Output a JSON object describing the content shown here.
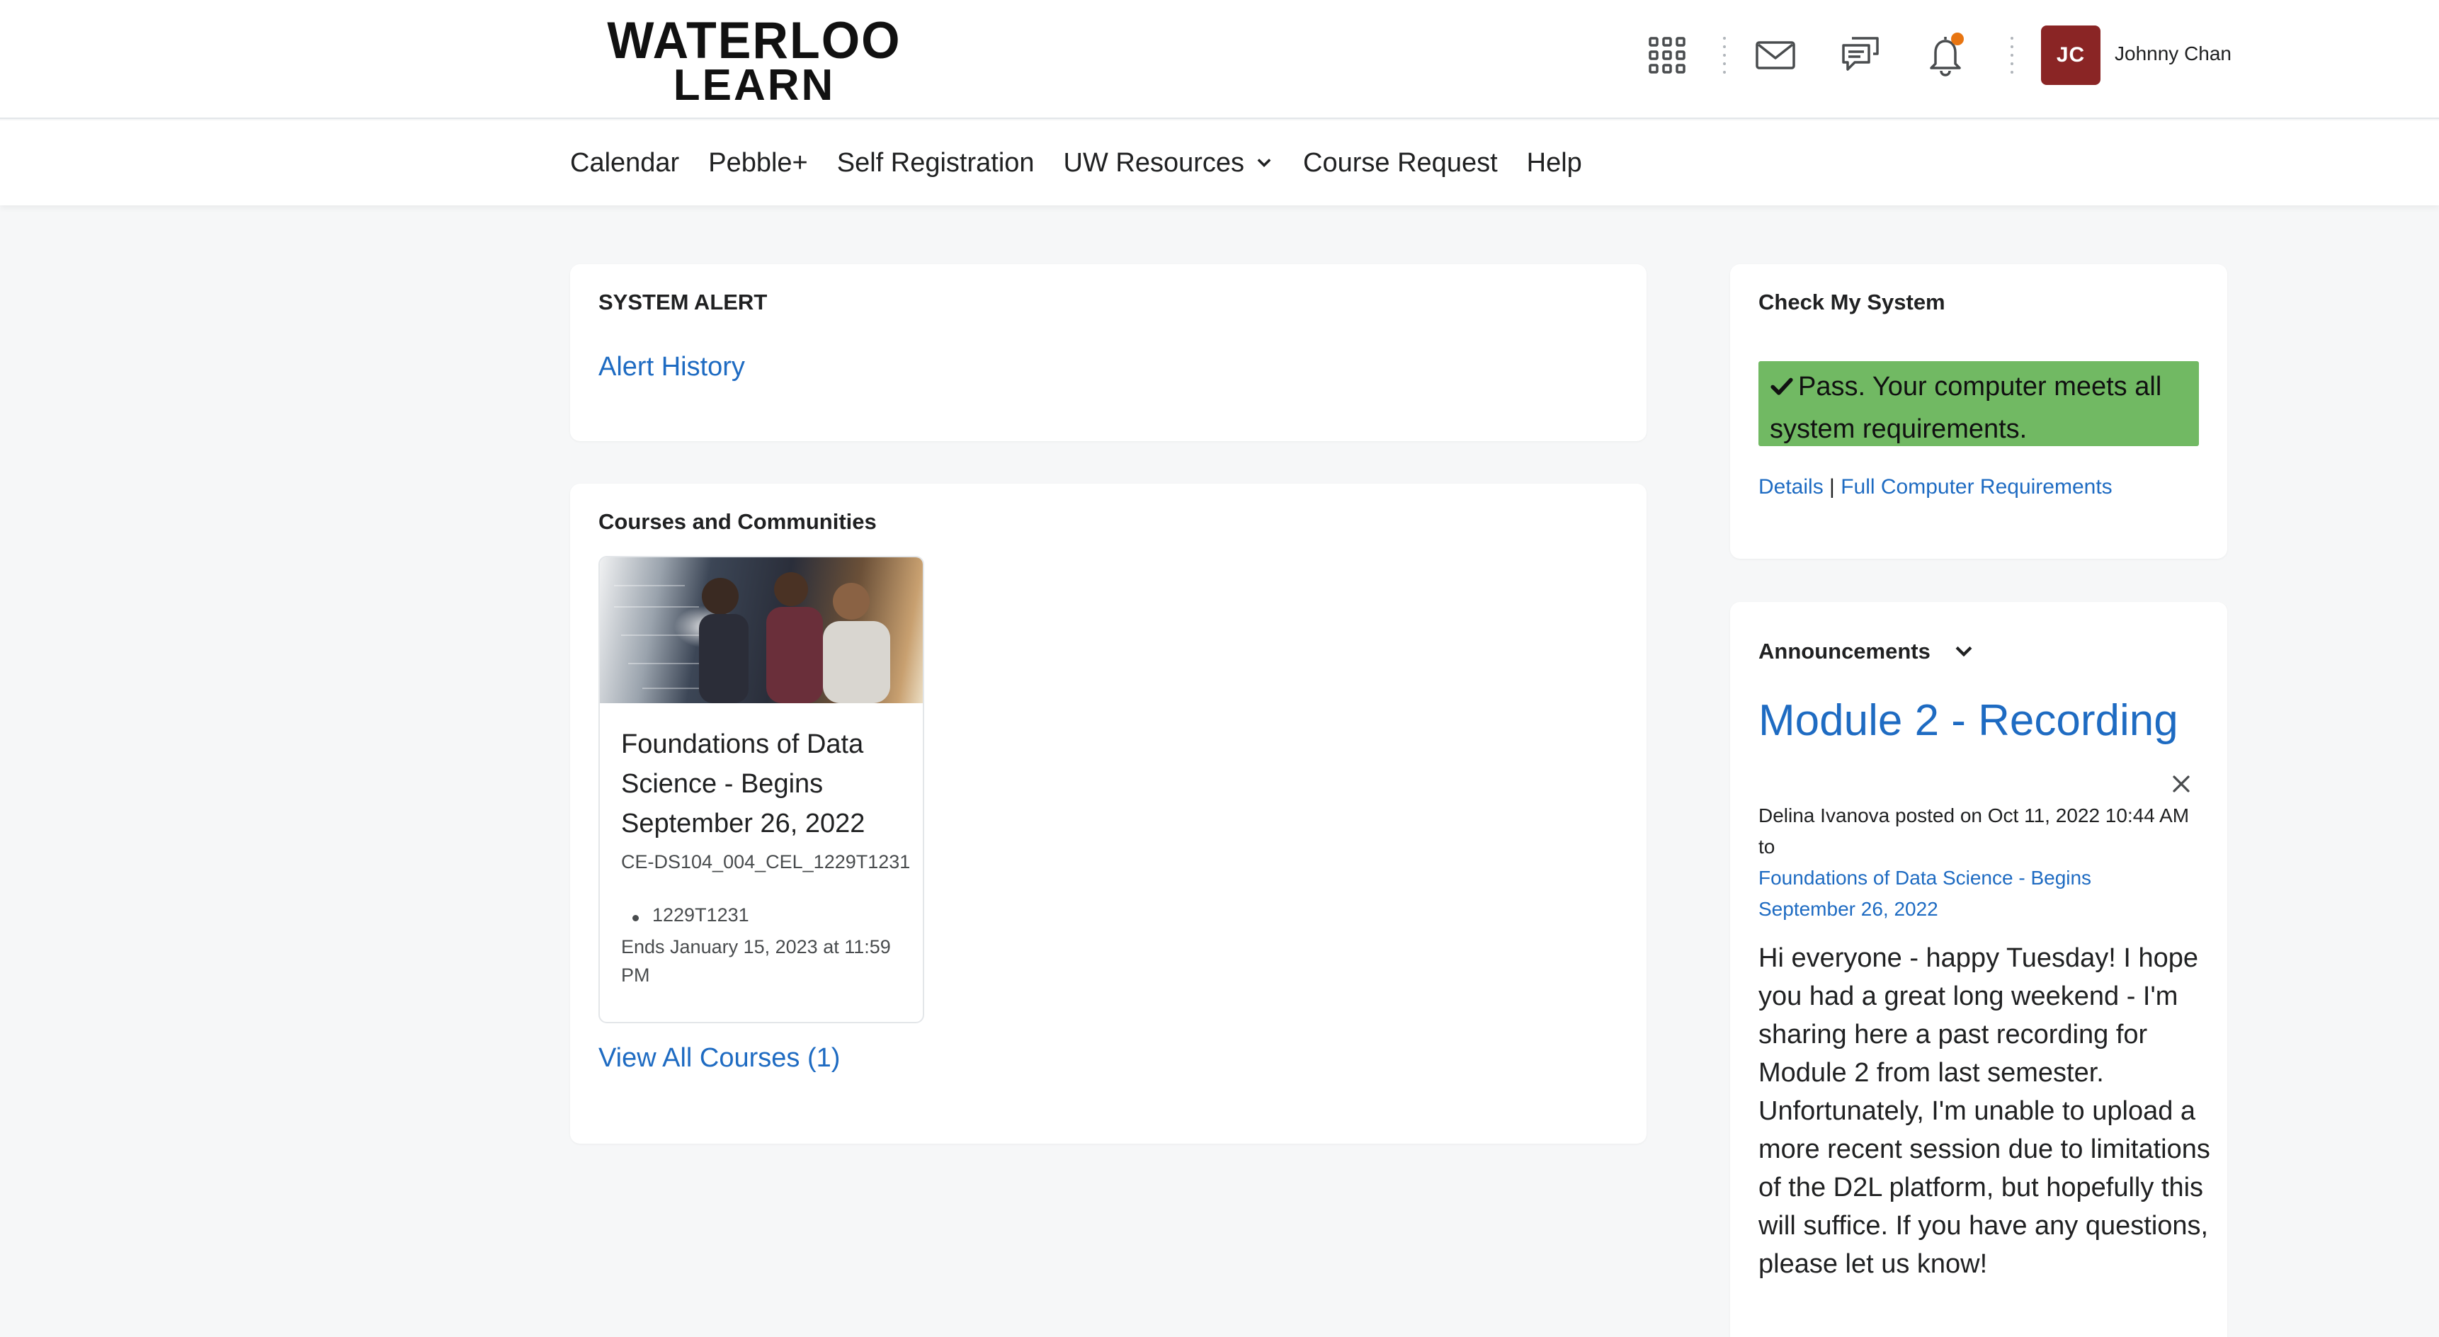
{
  "header": {
    "logo_line1": "WATERLOO",
    "logo_line2": "LEARN",
    "icons": [
      "apps-grid-icon",
      "mail-icon",
      "chat-icon",
      "bell-icon"
    ],
    "notification_dot_color": "#e87511",
    "user_initials": "JC",
    "user_name": "Johnny Chan",
    "avatar_color": "#8a2525"
  },
  "nav": {
    "items": [
      {
        "label": "Calendar"
      },
      {
        "label": "Pebble+"
      },
      {
        "label": "Self Registration"
      },
      {
        "label": "UW Resources"
      },
      {
        "label": "Course Request"
      },
      {
        "label": "Help"
      }
    ]
  },
  "system_alert": {
    "title": "SYSTEM ALERT",
    "link": "Alert History"
  },
  "courses": {
    "title": "Courses and Communities",
    "tile": {
      "name": "Foundations of Data Science - Begins September 26, 2022",
      "code": "CE-DS104_004_CEL_1229T1231",
      "term": "1229T1231",
      "ends": "Ends January 15, 2023 at 11:59 PM"
    },
    "view_all": "View All Courses (1)"
  },
  "check_system": {
    "title": "Check My System",
    "status": "Pass. Your computer meets all system requirements.",
    "status_color": "#71b963",
    "details_link": "Details",
    "separator": "|",
    "requirements_link": "Full Computer Requirements"
  },
  "announcements": {
    "title": "Announcements",
    "headline": "Module 2 - Recording",
    "meta": "Delina Ivanova posted on Oct 11, 2022 10:44 AM to",
    "course_link": "Foundations of Data Science - Begins September 26, 2022",
    "body": "Hi everyone - happy Tuesday! I hope you had a great long weekend - I'm sharing here a past recording for Module 2 from last semester. Unfortunately, I'm unable to upload a more recent session due to limitations of the D2L platform, but hopefully this will suffice. If you have any questions, please let us know!"
  },
  "colors": {
    "link": "#1e6bc2",
    "page_background": "#f6f7f8"
  }
}
